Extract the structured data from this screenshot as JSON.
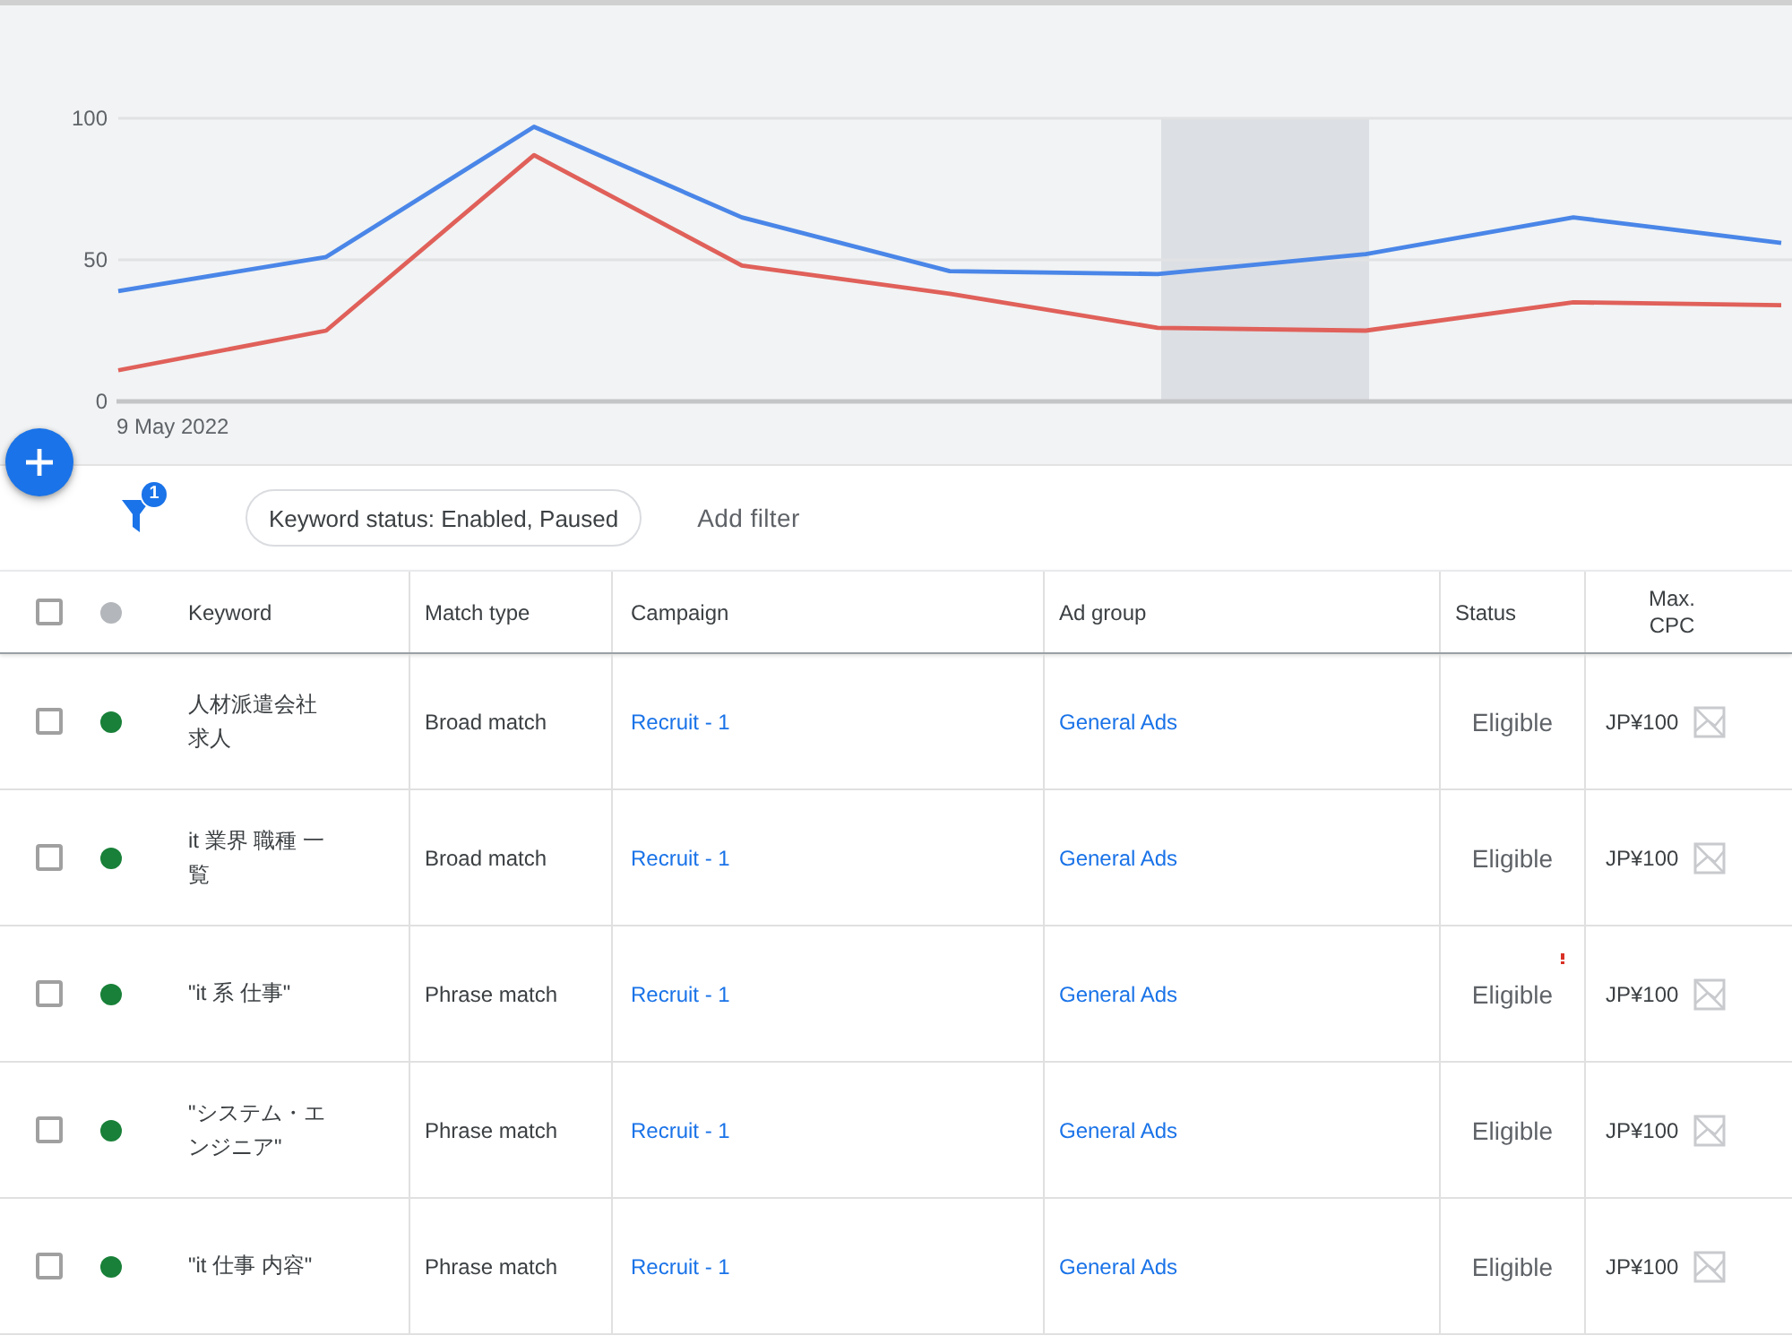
{
  "chart": {
    "start_label": "9 May 2022",
    "intervals": [
      {
        "highlighted": false
      },
      {
        "highlighted": false
      },
      {
        "highlighted": false
      },
      {
        "highlighted": false
      },
      {
        "highlighted": false
      },
      {
        "highlighted": true
      },
      {
        "highlighted": false
      },
      {
        "highlighted": false
      }
    ],
    "chart_data": {
      "type": "line",
      "yticks": [
        0,
        50,
        100
      ],
      "ylim": [
        0,
        100
      ],
      "series": [
        {
          "color": "#4a86e8",
          "values": [
            39,
            51,
            97,
            65,
            46,
            45,
            52,
            65,
            56
          ]
        },
        {
          "color": "#e0605a",
          "values": [
            11,
            25,
            87,
            48,
            38,
            26,
            25,
            35,
            34
          ]
        }
      ]
    }
  },
  "filters": {
    "count": "1",
    "chips": [
      {
        "label": "Keyword status: Enabled, Paused"
      }
    ],
    "add_filter": "Add filter"
  },
  "table": {
    "select_all": {
      "checked": false
    },
    "columns": [
      "Keyword",
      "Match type",
      "Campaign",
      "Ad group",
      "Status",
      "Max. CPC"
    ],
    "rows": [
      {
        "checked": false,
        "color": "#188038",
        "keyword": "人材派遣会社求人",
        "match_type": "Broad match",
        "campaign": "Recruit - 1",
        "ad_group": "General Ads",
        "status": "Eligible",
        "alert": false,
        "max_cpc": "JP¥100"
      },
      {
        "checked": false,
        "color": "#188038",
        "keyword": "it 業界 職種 一覧",
        "match_type": "Broad match",
        "campaign": "Recruit - 1",
        "ad_group": "General Ads",
        "status": "Eligible",
        "alert": false,
        "max_cpc": "JP¥100"
      },
      {
        "checked": false,
        "color": "#188038",
        "keyword": "\"it 系 仕事\"",
        "match_type": "Phrase match",
        "campaign": "Recruit - 1",
        "ad_group": "General Ads",
        "status": "Eligible",
        "alert": true,
        "max_cpc": "JP¥100"
      },
      {
        "checked": false,
        "color": "#188038",
        "keyword": "\"システム・エンジニア\"",
        "match_type": "Phrase match",
        "campaign": "Recruit - 1",
        "ad_group": "General Ads",
        "status": "Eligible",
        "alert": false,
        "max_cpc": "JP¥100"
      },
      {
        "checked": false,
        "color": "#188038",
        "keyword": "\"it 仕事 内容\"",
        "match_type": "Phrase match",
        "campaign": "Recruit - 1",
        "ad_group": "General Ads",
        "status": "Eligible",
        "alert": false,
        "max_cpc": "JP¥100"
      }
    ]
  }
}
